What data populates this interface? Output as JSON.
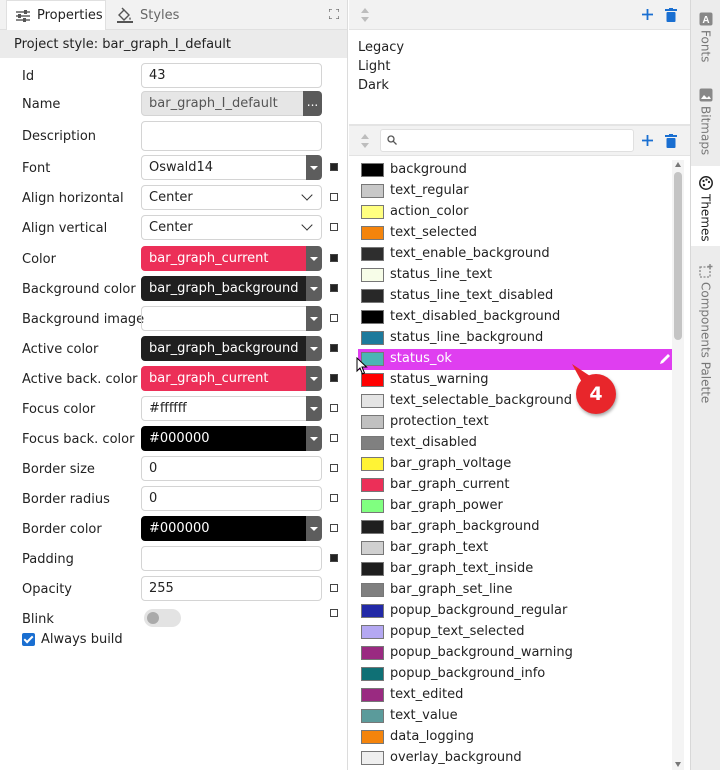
{
  "left_panel": {
    "tabs": [
      {
        "label": "Properties",
        "icon": "sliders-icon",
        "active": true
      },
      {
        "label": "Styles",
        "icon": "paint-bucket-icon",
        "active": false
      }
    ],
    "project_style": "Project style: bar_graph_I_default",
    "properties": {
      "id": {
        "label": "Id",
        "value": "43"
      },
      "name": {
        "label": "Name",
        "value": "bar_graph_I_default",
        "button": "..."
      },
      "description": {
        "label": "Description",
        "value": ""
      },
      "font": {
        "label": "Font",
        "value": "Oswald14"
      },
      "align_horizontal": {
        "label": "Align horizontal",
        "value": "Center"
      },
      "align_vertical": {
        "label": "Align vertical",
        "value": "Center"
      },
      "color": {
        "label": "Color",
        "value": "bar_graph_current",
        "bg": "#ec2f58",
        "fg": "#ffffff"
      },
      "background_color": {
        "label": "Background color",
        "value": "bar_graph_background",
        "bg": "#1f1f1f",
        "fg": "#ffffff"
      },
      "background_image": {
        "label": "Background image",
        "value": ""
      },
      "active_color": {
        "label": "Active color",
        "value": "bar_graph_background",
        "bg": "#1f1f1f",
        "fg": "#ffffff"
      },
      "active_back_color": {
        "label": "Active back. color",
        "value": "bar_graph_current",
        "bg": "#ec2f58",
        "fg": "#ffffff"
      },
      "focus_color": {
        "label": "Focus color",
        "value": "#ffffff",
        "bg": "#ffffff",
        "fg": "#222222"
      },
      "focus_back_color": {
        "label": "Focus back. color",
        "value": "#000000",
        "bg": "#000000",
        "fg": "#ffffff"
      },
      "border_size": {
        "label": "Border size",
        "value": "0"
      },
      "border_radius": {
        "label": "Border radius",
        "value": "0"
      },
      "border_color": {
        "label": "Border color",
        "value": "#000000",
        "bg": "#000000",
        "fg": "#ffffff"
      },
      "padding": {
        "label": "Padding",
        "value": ""
      },
      "opacity": {
        "label": "Opacity",
        "value": "255"
      },
      "blink": {
        "label": "Blink",
        "on": false
      },
      "always_build": {
        "label": "Always build",
        "checked": true
      }
    }
  },
  "themes_panel": {
    "themes": [
      "Legacy",
      "Light",
      "Dark"
    ],
    "search_placeholder": "",
    "colors": [
      {
        "name": "background",
        "hex": "#000000"
      },
      {
        "name": "text_regular",
        "hex": "#c8c8c8"
      },
      {
        "name": "action_color",
        "hex": "#ffff80"
      },
      {
        "name": "text_selected",
        "hex": "#f4840c"
      },
      {
        "name": "text_enable_background",
        "hex": "#2e2e2e"
      },
      {
        "name": "status_line_text",
        "hex": "#f7fde8"
      },
      {
        "name": "status_line_text_disabled",
        "hex": "#282828"
      },
      {
        "name": "text_disabled_background",
        "hex": "#000000"
      },
      {
        "name": "status_line_background",
        "hex": "#1d7a9c"
      },
      {
        "name": "status_ok",
        "hex": "#4ab5b5",
        "selected": true
      },
      {
        "name": "status_warning",
        "hex": "#ff0000"
      },
      {
        "name": "text_selectable_background",
        "hex": "#e4e4e4"
      },
      {
        "name": "protection_text",
        "hex": "#c0c0c0"
      },
      {
        "name": "text_disabled",
        "hex": "#808080"
      },
      {
        "name": "bar_graph_voltage",
        "hex": "#fff335"
      },
      {
        "name": "bar_graph_current",
        "hex": "#ec2f58"
      },
      {
        "name": "bar_graph_power",
        "hex": "#80ff80"
      },
      {
        "name": "bar_graph_background",
        "hex": "#1f1f1f"
      },
      {
        "name": "bar_graph_text",
        "hex": "#d0d0d0"
      },
      {
        "name": "bar_graph_text_inside",
        "hex": "#1e1e1e"
      },
      {
        "name": "bar_graph_set_line",
        "hex": "#7f7f7f"
      },
      {
        "name": "popup_background_regular",
        "hex": "#2229a7"
      },
      {
        "name": "popup_text_selected",
        "hex": "#b4a8f2"
      },
      {
        "name": "popup_background_warning",
        "hex": "#9a2a81"
      },
      {
        "name": "popup_background_info",
        "hex": "#0f7075"
      },
      {
        "name": "text_edited",
        "hex": "#9a2a81"
      },
      {
        "name": "text_value",
        "hex": "#5b9b9b"
      },
      {
        "name": "data_logging",
        "hex": "#f4840c"
      },
      {
        "name": "overlay_background",
        "hex": "#efefef"
      }
    ],
    "callout_number": "4"
  },
  "right_sidebar": {
    "tabs": [
      {
        "label": "Fonts",
        "icon": "font-icon",
        "active": false
      },
      {
        "label": "Bitmaps",
        "icon": "image-icon",
        "active": false
      },
      {
        "label": "Themes",
        "icon": "palette-icon",
        "active": true
      },
      {
        "label": "Components Palette",
        "icon": "components-icon",
        "active": false
      }
    ]
  },
  "colors": {
    "accent_blue": "#1a6fd1",
    "selection_magenta": "#df3ef0",
    "callout_red": "#e8262b"
  }
}
